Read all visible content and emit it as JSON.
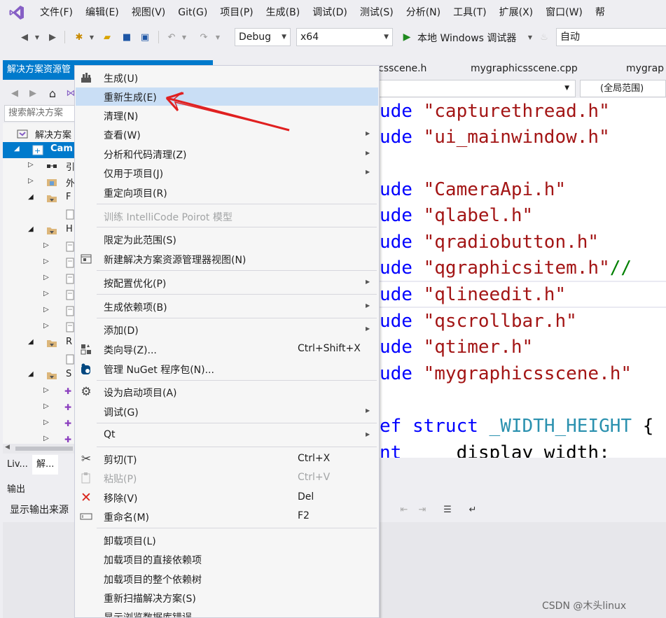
{
  "menubar": {
    "items": [
      "文件(F)",
      "编辑(E)",
      "视图(V)",
      "Git(G)",
      "项目(P)",
      "生成(B)",
      "调试(D)",
      "测试(S)",
      "分析(N)",
      "工具(T)",
      "扩展(X)",
      "窗口(W)",
      "帮"
    ]
  },
  "toolbar": {
    "config": "Debug",
    "platform": "x64",
    "run_label": "本地 Windows 调试器",
    "auto": "自动"
  },
  "solution_explorer": {
    "title": "解决方案资源管",
    "search_placeholder": "搜索解决方案",
    "tree": [
      {
        "label": "解决方案",
        "icon": "solution-icon"
      },
      {
        "label": "Cam",
        "icon": "project-icon"
      },
      {
        "label": "引",
        "icon": "references-icon"
      },
      {
        "label": "外",
        "icon": "external-deps-icon"
      },
      {
        "label": "F",
        "icon": "folder-icon"
      },
      {
        "label": "",
        "icon": "file-icon"
      },
      {
        "label": "H",
        "icon": "folder-icon"
      },
      {
        "label": "",
        "icon": "header-file-icon"
      },
      {
        "label": "",
        "icon": "header-file-icon"
      },
      {
        "label": "",
        "icon": "header-file-icon"
      },
      {
        "label": "",
        "icon": "header-file-icon"
      },
      {
        "label": "",
        "icon": "header-file-icon"
      },
      {
        "label": "",
        "icon": "header-file-icon"
      },
      {
        "label": "R",
        "icon": "folder-icon"
      },
      {
        "label": "",
        "icon": "file-icon"
      },
      {
        "label": "S",
        "icon": "folder-icon"
      },
      {
        "label": "",
        "icon": "cpp-file-icon"
      },
      {
        "label": "",
        "icon": "cpp-file-icon"
      },
      {
        "label": "",
        "icon": "cpp-file-icon"
      },
      {
        "label": "",
        "icon": "cpp-file-icon"
      }
    ],
    "bottom_tabs": [
      "Liv...",
      "解..."
    ]
  },
  "editor": {
    "tabs": [
      "csscene.h",
      "mygraphicsscene.cpp",
      "mygrap"
    ],
    "scope": "(全局范围)",
    "lines": [
      {
        "kw": "ude ",
        "str": "\"capturethread.h\"",
        "rest": ""
      },
      {
        "kw": "ude ",
        "str": "\"ui_mainwindow.h\"",
        "rest": ""
      },
      {
        "kw": "",
        "str": "",
        "rest": ""
      },
      {
        "kw": "ude ",
        "str": "\"CameraApi.h\"",
        "rest": ""
      },
      {
        "kw": "ude ",
        "str": "\"qlabel.h\"",
        "rest": ""
      },
      {
        "kw": "ude ",
        "str": "\"qradiobutton.h\"",
        "rest": ""
      },
      {
        "kw": "ude ",
        "str": "\"qgraphicsitem.h\"",
        "rest": "//"
      },
      {
        "kw": "ude ",
        "str": "\"qlineedit.h\"",
        "rest": ""
      },
      {
        "kw": "ude ",
        "str": "\"qscrollbar.h\"",
        "rest": ""
      },
      {
        "kw": "ude ",
        "str": "\"qtimer.h\"",
        "rest": ""
      },
      {
        "kw": "ude ",
        "str": "\"mygraphicsscene.h\"",
        "rest": ""
      }
    ],
    "struct_kw1": "ef",
    "struct_kw2": "struct",
    "struct_name": "_WIDTH_HEIGHT",
    "struct_brace": "{",
    "last_kw": "nt",
    "last_text": "     display_width;"
  },
  "output": {
    "title": "输出",
    "source_label": "显示输出来源"
  },
  "context_menu": {
    "items": [
      {
        "label": "生成(U)",
        "shortcut": "",
        "icon": "build-icon",
        "submenu": false,
        "disabled": false
      },
      {
        "label": "重新生成(E)",
        "shortcut": "",
        "icon": "",
        "submenu": false,
        "disabled": false
      },
      {
        "label": "清理(N)",
        "shortcut": "",
        "icon": "",
        "submenu": false,
        "disabled": false
      },
      {
        "label": "查看(W)",
        "shortcut": "",
        "icon": "",
        "submenu": true,
        "disabled": false
      },
      {
        "label": "分析和代码清理(Z)",
        "shortcut": "",
        "icon": "",
        "submenu": true,
        "disabled": false
      },
      {
        "label": "仅用于项目(J)",
        "shortcut": "",
        "icon": "",
        "submenu": true,
        "disabled": false
      },
      {
        "label": "重定向项目(R)",
        "shortcut": "",
        "icon": "",
        "submenu": false,
        "disabled": false
      },
      {
        "label": "训练 IntelliCode Poirot 模型",
        "shortcut": "",
        "icon": "",
        "submenu": false,
        "disabled": true
      },
      {
        "label": "限定为此范围(S)",
        "shortcut": "",
        "icon": "",
        "submenu": false,
        "disabled": false
      },
      {
        "label": "新建解决方案资源管理器视图(N)",
        "shortcut": "",
        "icon": "new-view-icon",
        "submenu": false,
        "disabled": false
      },
      {
        "label": "按配置优化(P)",
        "shortcut": "",
        "icon": "",
        "submenu": true,
        "disabled": false
      },
      {
        "label": "生成依赖项(B)",
        "shortcut": "",
        "icon": "",
        "submenu": true,
        "disabled": false
      },
      {
        "label": "添加(D)",
        "shortcut": "",
        "icon": "",
        "submenu": true,
        "disabled": false
      },
      {
        "label": "类向导(Z)...",
        "shortcut": "Ctrl+Shift+X",
        "icon": "class-wizard-icon",
        "submenu": false,
        "disabled": false
      },
      {
        "label": "管理 NuGet 程序包(N)...",
        "shortcut": "",
        "icon": "nuget-icon",
        "submenu": false,
        "disabled": false
      },
      {
        "label": "设为启动项目(A)",
        "shortcut": "",
        "icon": "gear-icon",
        "submenu": false,
        "disabled": false
      },
      {
        "label": "调试(G)",
        "shortcut": "",
        "icon": "",
        "submenu": true,
        "disabled": false
      },
      {
        "label": "Qt",
        "shortcut": "",
        "icon": "",
        "submenu": true,
        "disabled": false
      },
      {
        "label": "剪切(T)",
        "shortcut": "Ctrl+X",
        "icon": "scissors-icon",
        "submenu": false,
        "disabled": false
      },
      {
        "label": "粘贴(P)",
        "shortcut": "Ctrl+V",
        "icon": "paste-icon",
        "submenu": false,
        "disabled": true
      },
      {
        "label": "移除(V)",
        "shortcut": "Del",
        "icon": "remove-x-icon",
        "submenu": false,
        "disabled": false
      },
      {
        "label": "重命名(M)",
        "shortcut": "F2",
        "icon": "rename-icon",
        "submenu": false,
        "disabled": false
      },
      {
        "label": "卸载项目(L)",
        "shortcut": "",
        "icon": "",
        "submenu": false,
        "disabled": false
      },
      {
        "label": "加载项目的直接依赖项",
        "shortcut": "",
        "icon": "",
        "submenu": false,
        "disabled": false
      },
      {
        "label": "加载项目的整个依赖树",
        "shortcut": "",
        "icon": "",
        "submenu": false,
        "disabled": false
      },
      {
        "label": "重新扫描解决方案(S)",
        "shortcut": "",
        "icon": "",
        "submenu": false,
        "disabled": false
      },
      {
        "label": "显示浏览数据库错误",
        "shortcut": "",
        "icon": "",
        "submenu": false,
        "disabled": false
      }
    ]
  },
  "watermark": "CSDN @木头linux",
  "colors": {
    "accent": "#007acc",
    "highlight": "#c9def5",
    "annotation": "#e02020"
  }
}
